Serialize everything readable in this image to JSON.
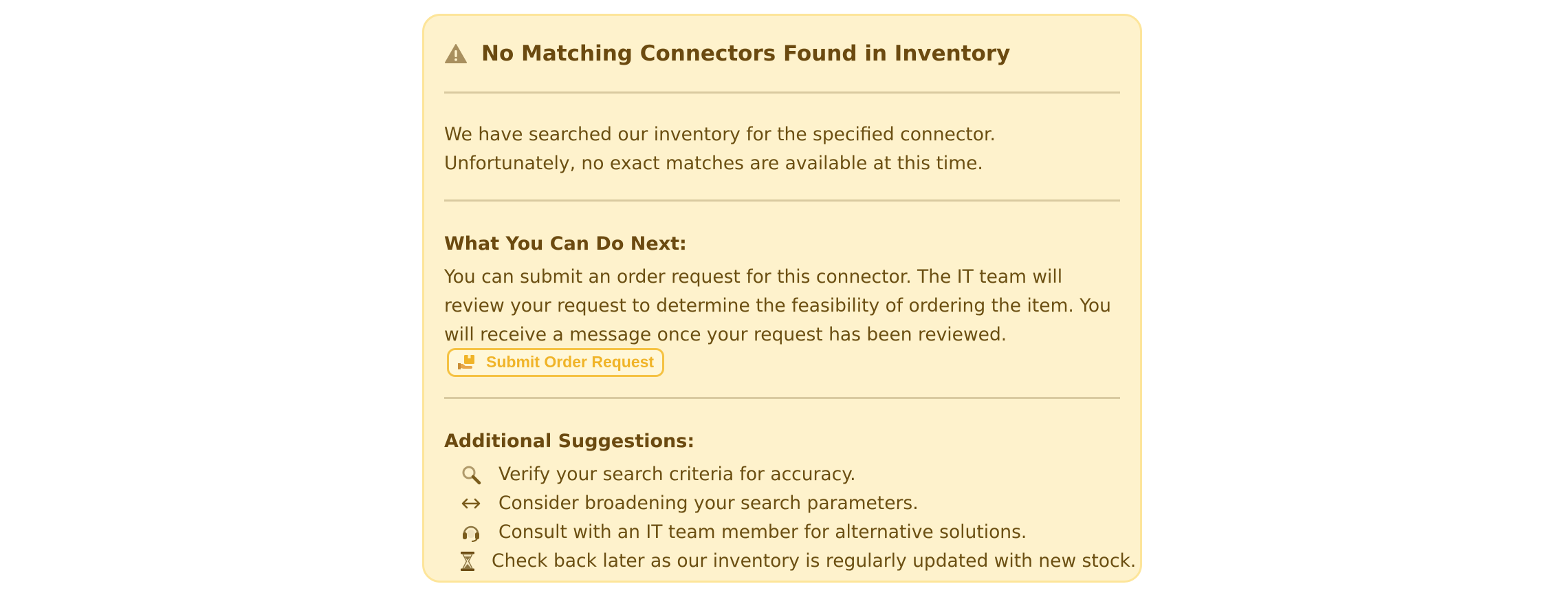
{
  "alert": {
    "title": "No Matching Connectors Found in Inventory",
    "icon": "warning-icon",
    "message": "We have searched our inventory for the specified connector. Unfortunately, no exact matches are available at this time."
  },
  "next_steps": {
    "heading": "What You Can Do Next:",
    "text": "You can submit an order request for this connector. The IT team will review your request to determine the feasibility of ordering the item. You will receive a message once your request has been reviewed.",
    "button_label": "Submit Order Request",
    "button_icon": "package-icon"
  },
  "suggestions": {
    "heading": "Additional Suggestions:",
    "items": [
      {
        "icon": "search-icon",
        "text": "Verify your search criteria for accuracy."
      },
      {
        "icon": "arrows-horizontal-icon",
        "text": "Consider broadening your search parameters."
      },
      {
        "icon": "headset-icon",
        "text": "Consult with an IT team member for alternative solutions."
      },
      {
        "icon": "hourglass-icon",
        "text": "Check back later as our inventory is regularly updated with new stock."
      }
    ]
  },
  "colors": {
    "card_background": "#fef2cc",
    "card_border": "#fde59a",
    "text": "#6b4f12",
    "accent": "#f0b429"
  }
}
